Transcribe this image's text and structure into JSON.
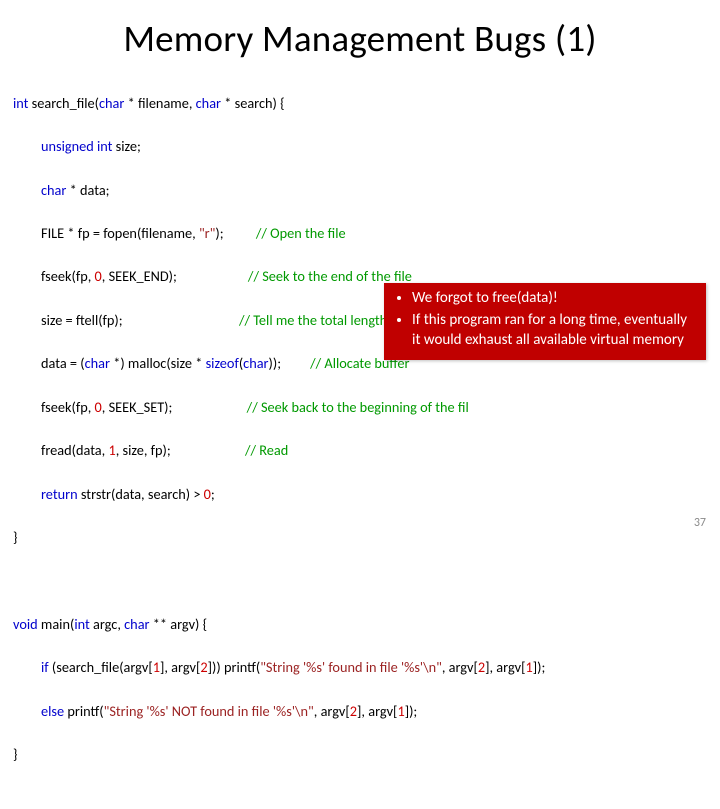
{
  "title": "Memory Management Bugs (1)",
  "code": {
    "l01a": "int",
    "l01b": " search_file(",
    "l01c": "char",
    "l01d": " * filename, ",
    "l01e": "char",
    "l01f": " * search) {",
    "l02a": "unsigned int",
    "l02b": " size;",
    "l03a": "char",
    "l03b": " * data;",
    "l04a": "FILE * fp = fopen(filename, ",
    "l04b": "\"r\"",
    "l04c": ");",
    "l04cmt": "// Open the file",
    "l05a": "fseek(fp, ",
    "l05b": "0",
    "l05c": ", SEEK_END);",
    "l05cmt": "// Seek to the end of the file",
    "l06a": "size = ftell(fp);",
    "l06cmt": "// Tell me the total length of the file",
    "l07a": "data = (",
    "l07b": "char",
    "l07c": " *) malloc(size * ",
    "l07d": "sizeof",
    "l07e": "(",
    "l07f": "char",
    "l07g": "));",
    "l07cmt": "// Allocate buffer",
    "l08a": "fseek(fp, ",
    "l08b": "0",
    "l08c": ", SEEK_SET);",
    "l08cmt": "// Seek back to the beginning of the fil",
    "l09a": "fread(data, ",
    "l09b": "1",
    "l09c": ", size, fp);",
    "l09cmt": "// Read",
    "l10a": "return",
    "l10b": " strstr(data, search) > ",
    "l10c": "0",
    "l10d": ";",
    "l11": "}",
    "blank1": " ",
    "l12a": "void",
    "l12b": " main(",
    "l12c": "int",
    "l12d": " argc, ",
    "l12e": "char",
    "l12f": " ** argv) {",
    "l13a": "if",
    "l13b": " (search_file(argv[",
    "l13c": "1",
    "l13d": "], argv[",
    "l13e": "2",
    "l13f": "])) printf(",
    "l13g": "\"String '%s' found in file '%s'\\n\"",
    "l13h": ", argv[",
    "l13i": "2",
    "l13j": "], argv[",
    "l13k": "1",
    "l13l": "]);",
    "l14a": "else",
    "l14b": " printf(",
    "l14c": "\"String '%s' NOT found in file '%s'\\n\"",
    "l14d": ", argv[",
    "l14e": "2",
    "l14f": "], argv[",
    "l14g": "1",
    "l14h": "]);",
    "l15": "}"
  },
  "callout": {
    "item1": "We forgot to free(data)!",
    "item2": "If this program ran for a long time, eventually it would exhaust all available virtual memory"
  },
  "pagenum": "37"
}
